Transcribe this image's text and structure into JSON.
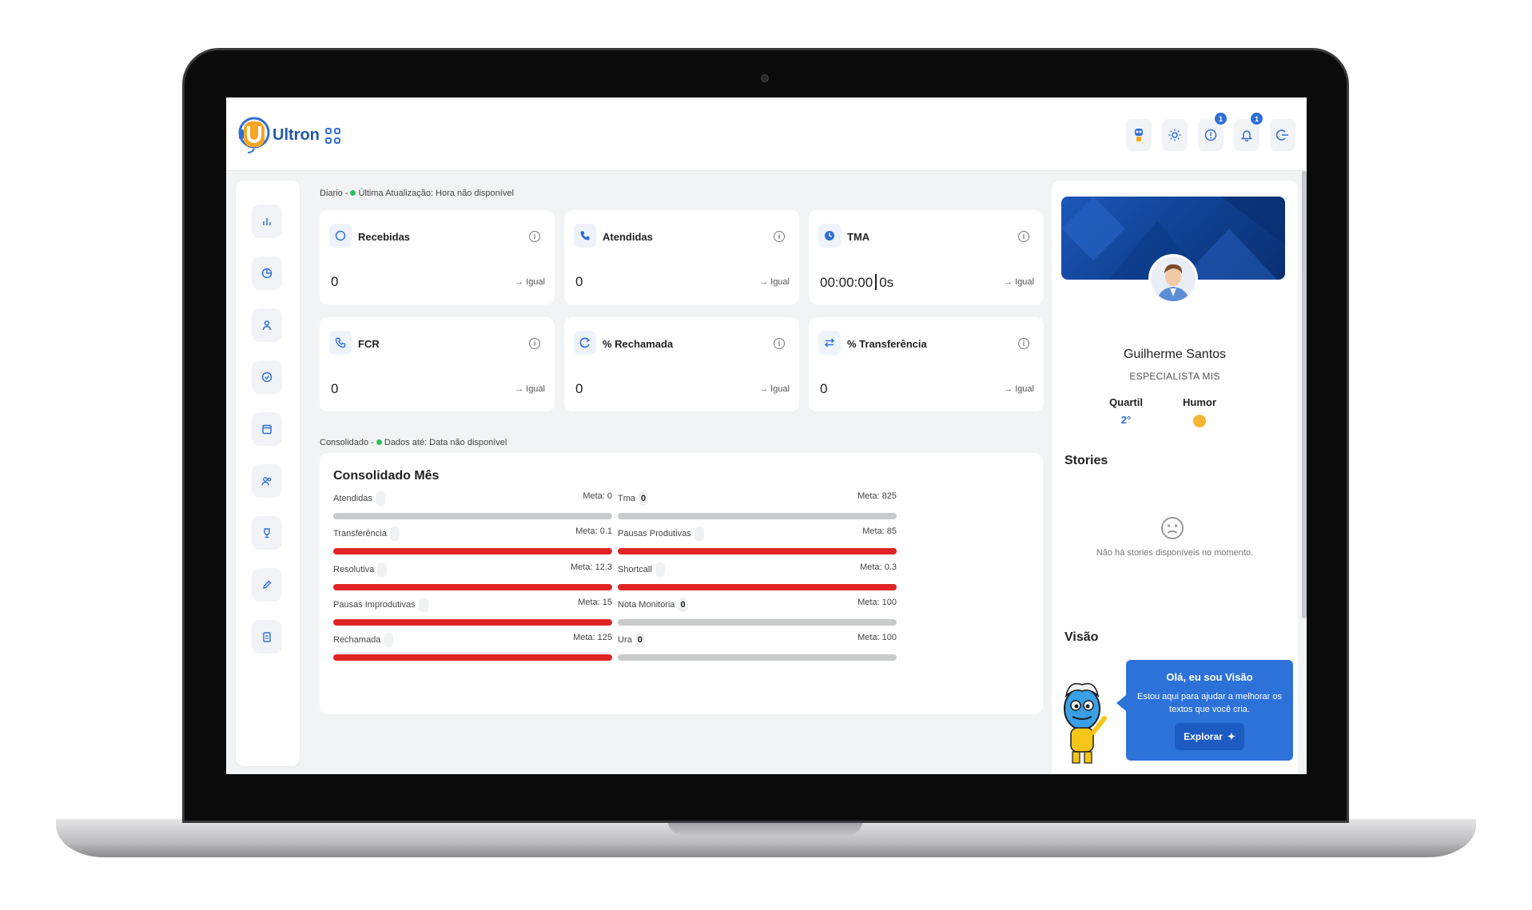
{
  "app": {
    "brand": "Ultron",
    "header_actions": [
      {
        "icon": "robot-icon",
        "badge": ""
      },
      {
        "icon": "sun-icon",
        "badge": ""
      },
      {
        "icon": "alert-circle-icon",
        "badge": "1"
      },
      {
        "icon": "bell-icon",
        "badge": "1"
      },
      {
        "icon": "logout-icon",
        "badge": ""
      }
    ]
  },
  "sidebar": {
    "items": [
      "chart-bar-icon",
      "pie-chart-icon",
      "user-icon",
      "clock-check-icon",
      "calendar-icon",
      "users-icon",
      "trophy-icon",
      "pencil-icon",
      "clipboard-icon"
    ]
  },
  "daily": {
    "label_prefix": "Diario -",
    "label_text": "Última Atualização: Hora não disponível",
    "status_color": "#2dbf5a",
    "kpis": [
      {
        "title": "Recebidas",
        "icon": "phone-incoming-icon",
        "value": "0",
        "trend": "→ Igual"
      },
      {
        "title": "Atendidas",
        "icon": "phone-icon",
        "value": "0",
        "trend": "→ Igual"
      },
      {
        "title": "TMA",
        "icon": "clock-icon",
        "value": "00:00:00",
        "value_extra": "0s",
        "trend": "→ Igual"
      },
      {
        "title": "FCR",
        "icon": "phone-call-icon",
        "value": "0",
        "trend": "→ Igual"
      },
      {
        "title": "% Rechamada",
        "icon": "redo-icon",
        "value": "0",
        "trend": "→ Igual"
      },
      {
        "title": "% Transferência",
        "icon": "transfer-icon",
        "value": "0",
        "trend": "→ Igual"
      }
    ]
  },
  "consolidated": {
    "label_prefix": "Consolidado -",
    "label_text": "Dados até: Data não disponível",
    "title": "Consolidado Mês",
    "metrics": [
      {
        "label": "Atendidas",
        "value": "",
        "meta": "Meta: 0",
        "bar": "gray"
      },
      {
        "label": "Tma",
        "value": "0",
        "meta": "Meta: 825",
        "bar": "gray"
      },
      {
        "label": "Transferência",
        "value": "",
        "meta": "Meta: 0.1",
        "bar": "red"
      },
      {
        "label": "Pausas Produtivas",
        "value": "",
        "meta": "Meta: 85",
        "bar": "red"
      },
      {
        "label": "Resolutiva",
        "value": "",
        "meta": "Meta: 12.3",
        "bar": "red"
      },
      {
        "label": "Shortcall",
        "value": "",
        "meta": "Meta: 0.3",
        "bar": "red"
      },
      {
        "label": "Pausas Improdutivas",
        "value": "",
        "meta": "Meta: 15",
        "bar": "red"
      },
      {
        "label": "Nota Monitoria",
        "value": "0",
        "meta": "Meta: 100",
        "bar": "gray"
      },
      {
        "label": "Rechamada",
        "value": "",
        "meta": "Meta: 125",
        "bar": "red"
      },
      {
        "label": "Ura",
        "value": "0",
        "meta": "Meta: 100",
        "bar": "gray"
      }
    ]
  },
  "profile": {
    "name": "Guilherme Santos",
    "role": "ESPECIALISTA MIS",
    "quartil_label": "Quartil",
    "quartil_value": "2°",
    "humor_label": "Humor",
    "stories_title": "Stories",
    "stories_empty": "Não há stories disponíveis no momento.",
    "visao_title": "Visão",
    "visao_heading": "Olá, eu sou Visão",
    "visao_text": "Estou aqui para ajudar a melhorar os textos que você cria.",
    "visao_button": "Explorar"
  },
  "colors": {
    "accent": "#2f6fd6",
    "danger": "#e02424",
    "track": "#c9cacc",
    "brand_orange": "#f5a623"
  }
}
